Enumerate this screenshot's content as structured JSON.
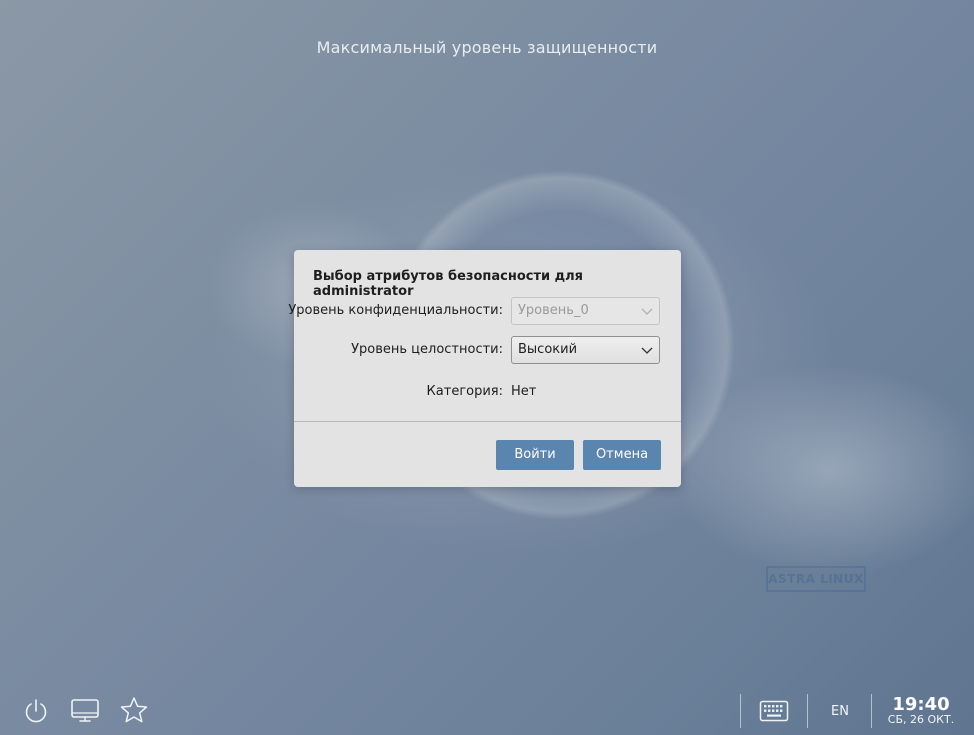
{
  "screen": {
    "header_title": "Максимальный уровень защищенности",
    "watermark": "ASTRA LINUX"
  },
  "dialog": {
    "title": "Выбор атрибутов безопасности для administrator",
    "confidentiality": {
      "label": "Уровень конфиденциальности:",
      "value": "Уровень_0",
      "enabled": false
    },
    "integrity": {
      "label": "Уровень целостности:",
      "value": "Высокий",
      "enabled": true
    },
    "category": {
      "label": "Категория:",
      "value": "Нет"
    },
    "login_button": "Войти",
    "cancel_button": "Отмена"
  },
  "taskbar": {
    "left_icons": [
      "power-icon",
      "monitor-icon",
      "star-icon"
    ],
    "keyboard_icon": "keyboard-icon",
    "language": "EN",
    "time": "19:40",
    "date": "СБ, 26 ОКТ."
  },
  "colors": {
    "button_bg": "#5a85af",
    "dialog_bg": "#e3e3e3"
  }
}
